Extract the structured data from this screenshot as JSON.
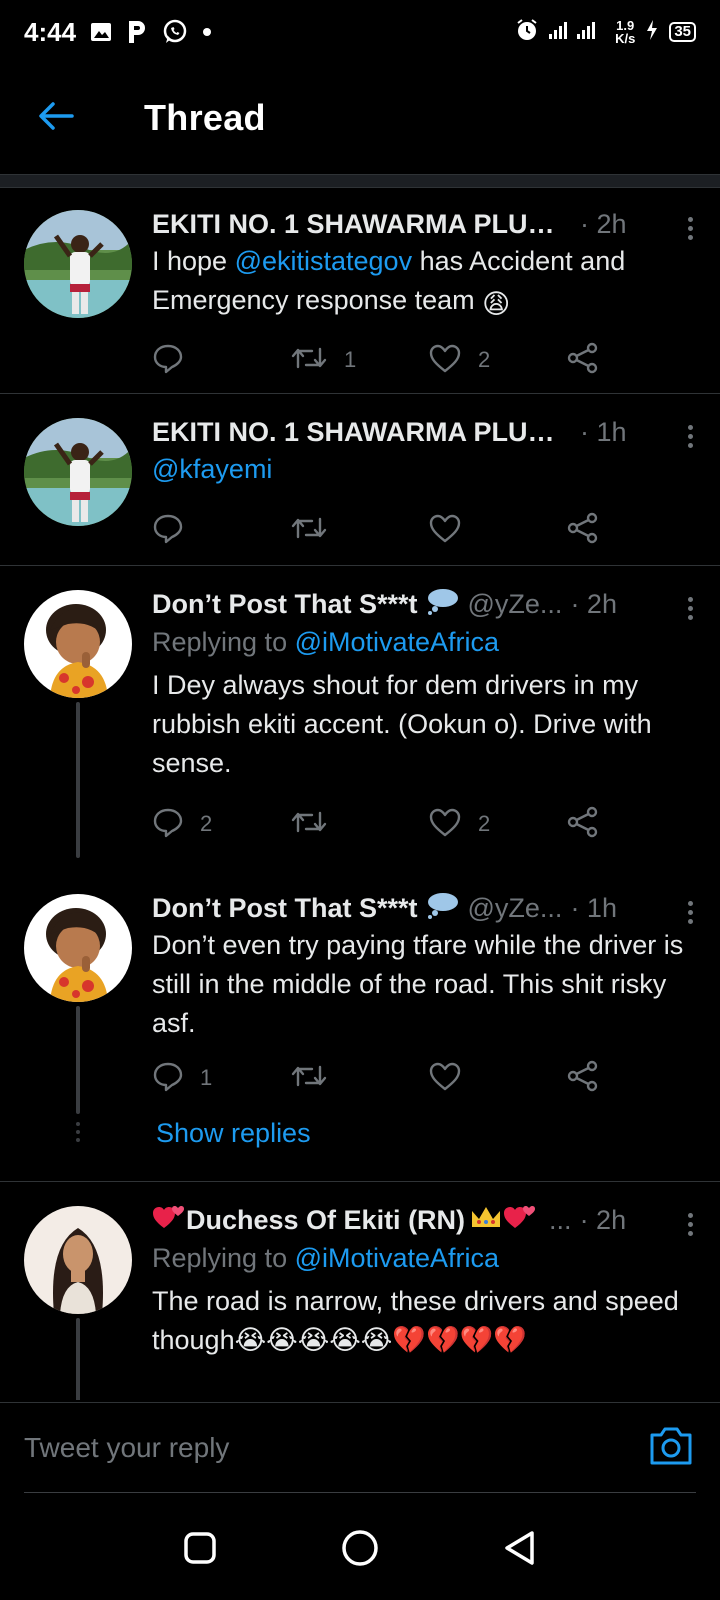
{
  "status_bar": {
    "time": "4:44",
    "network_speed_value": "1.9",
    "network_speed_unit": "K/s",
    "battery": "35"
  },
  "header": {
    "title": "Thread"
  },
  "tweets": [
    {
      "name": "EKITI NO. 1 SHAWARMA PLUG ...",
      "time": "· 2h",
      "text_parts": [
        "I hope ",
        "@ekitistategov",
        " has Accident and Emergency response team "
      ],
      "emoji": "😩",
      "reply_count": "",
      "retweet_count": "1",
      "like_count": "2"
    },
    {
      "name": "EKITI NO. 1 SHAWARMA PLUG ...",
      "time": "· 1h",
      "text": "@kfayemi",
      "reply_count": "",
      "retweet_count": "",
      "like_count": ""
    },
    {
      "name": "Don’t Post That S***t",
      "handle": "@yZe...",
      "time": "· 2h",
      "replying_label": "Replying to ",
      "replying_to": "@iMotivateAfrica",
      "text": "I Dey always shout for dem drivers in my rubbish ekiti accent. (Ookun o). Drive with sense.",
      "reply_count": "2",
      "retweet_count": "",
      "like_count": "2"
    },
    {
      "name": "Don’t Post That S***t",
      "handle": "@yZe...",
      "time": "· 1h",
      "text": "Don’t even try paying tfare while the driver is still in the middle of the road. This shit risky asf.",
      "reply_count": "1",
      "retweet_count": "",
      "like_count": "",
      "show_replies": "Show replies"
    },
    {
      "name": "Duchess Of Ekiti (RN)",
      "time": "· 2h",
      "ellipsis": "...",
      "replying_label": "Replying to ",
      "replying_to": "@iMotivateAfrica",
      "text": "The road is narrow, these drivers and speed though",
      "emoji_trail": "😭😭😭😭😭💔💔💔💔",
      "reply_count": "",
      "retweet_count": "",
      "like_count": ""
    }
  ],
  "composer": {
    "placeholder": "Tweet your reply"
  },
  "colors": {
    "accent": "#1d9bf0",
    "muted": "#71767b",
    "background": "#000000",
    "text": "#e7e9ea"
  },
  "icons": [
    "back-arrow-icon",
    "reply-icon",
    "retweet-icon",
    "like-icon",
    "share-icon",
    "more-icon",
    "camera-icon",
    "nav-recents-icon",
    "nav-home-icon",
    "nav-back-icon"
  ]
}
